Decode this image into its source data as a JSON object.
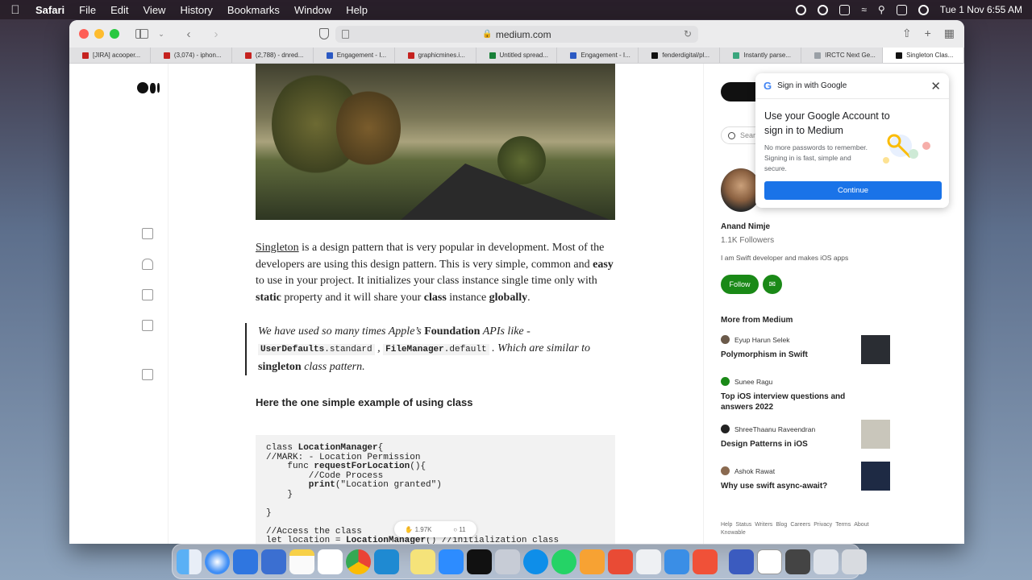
{
  "menubar": {
    "app_name": "Safari",
    "menus": [
      "File",
      "Edit",
      "View",
      "History",
      "Bookmarks",
      "Window",
      "Help"
    ],
    "datetime": "Tue 1 Nov  6:55 AM"
  },
  "browser": {
    "url": "medium.com",
    "tabs": [
      {
        "label": "[JIRA] acooper...",
        "color": "#c5221f"
      },
      {
        "label": "(3,074) - iphon...",
        "color": "#c5221f"
      },
      {
        "label": "(2,788) - dnred...",
        "color": "#c5221f"
      },
      {
        "label": "Engagement - I...",
        "color": "#2b59c3"
      },
      {
        "label": "graphicmines.i...",
        "color": "#c5221f"
      },
      {
        "label": "Untitled spread...",
        "color": "#188038"
      },
      {
        "label": "Engagement - I...",
        "color": "#2b59c3"
      },
      {
        "label": "fenderdigital/pl...",
        "color": "#111111"
      },
      {
        "label": "Instantly parse...",
        "color": "#3aa67d"
      },
      {
        "label": "IRCTC Next Ge...",
        "color": "#9aa0a6"
      },
      {
        "label": "Singleton Clas...",
        "color": "#111111"
      }
    ]
  },
  "article": {
    "para_link": "Singleton",
    "para_1": " is a design pattern that is very popular in development. Most of the developers are using this design pattern. This is very simple, common and ",
    "para_easy": "easy",
    "para_2": " to use in your project. It initializes your class instance single time only with ",
    "para_static": "static",
    "para_3": " property and it will share your ",
    "para_class": "class",
    "para_4": " instance ",
    "para_globally": "globally",
    "para_5": ".",
    "quote_1": "We have used so many times Apple’s ",
    "quote_foundation": "Foundation",
    "quote_2": " APIs like -",
    "quote_code1_a": "UserDefaults",
    "quote_code1_b": ".standard",
    "quote_sep": " , ",
    "quote_code2_a": "FileManager",
    "quote_code2_b": ".default",
    "quote_3": " . Which are similar to",
    "quote_singleton": "singleton",
    "quote_4": " class pattern.",
    "subheading": "Here the one simple example of using class",
    "code_kw": "class ",
    "code_name": "LocationManager",
    "code_open": "{",
    "code_mark": "//MARK: - Location Permission",
    "code_func": "    func ",
    "code_fname": "requestForLocation",
    "code_fopen": "(){",
    "code_comment": "        //Code Process",
    "code_print": "        print",
    "code_print_arg": "(\"Location granted\")",
    "code_close_inner": "    }",
    "code_close": "}",
    "code_access": "//Access the class",
    "code_let": "let location = ",
    "code_init": "LocationManager",
    "code_init_rest": "() //initialization class",
    "claps": "1.97K",
    "comments": "11"
  },
  "sidebar": {
    "search_placeholder": "Search",
    "author_name": "Anand Nimje",
    "followers": "1.1K Followers",
    "bio": "I am Swift developer and makes iOS apps",
    "follow_label": "Follow",
    "more_title": "More from Medium",
    "stories": [
      {
        "author": "Eyup Harun Selek",
        "title": "Polymorphism in Swift",
        "thumb": "#2a2d33"
      },
      {
        "author": "Sunee Ragu",
        "title": "Top iOS interview questions and answers 2022",
        "thumb": ""
      },
      {
        "author": "ShreeThaanu Raveendran",
        "title": "Design Patterns in iOS",
        "thumb": "#c9c6bb"
      },
      {
        "author": "Ashok Rawat",
        "title": "Why use swift async-await?",
        "thumb": "#1e2a44"
      }
    ],
    "footer": [
      "Help",
      "Status",
      "Writers",
      "Blog",
      "Careers",
      "Privacy",
      "Terms",
      "About",
      "Knowable"
    ]
  },
  "google_popup": {
    "header": "Sign in with Google",
    "title": "Use your Google Account to sign in to Medium",
    "desc": "No more passwords to remember. Signing in is fast, simple and secure.",
    "button": "Continue"
  },
  "colors": {
    "medium_green": "#1a8917",
    "google_blue": "#1a73e8"
  }
}
